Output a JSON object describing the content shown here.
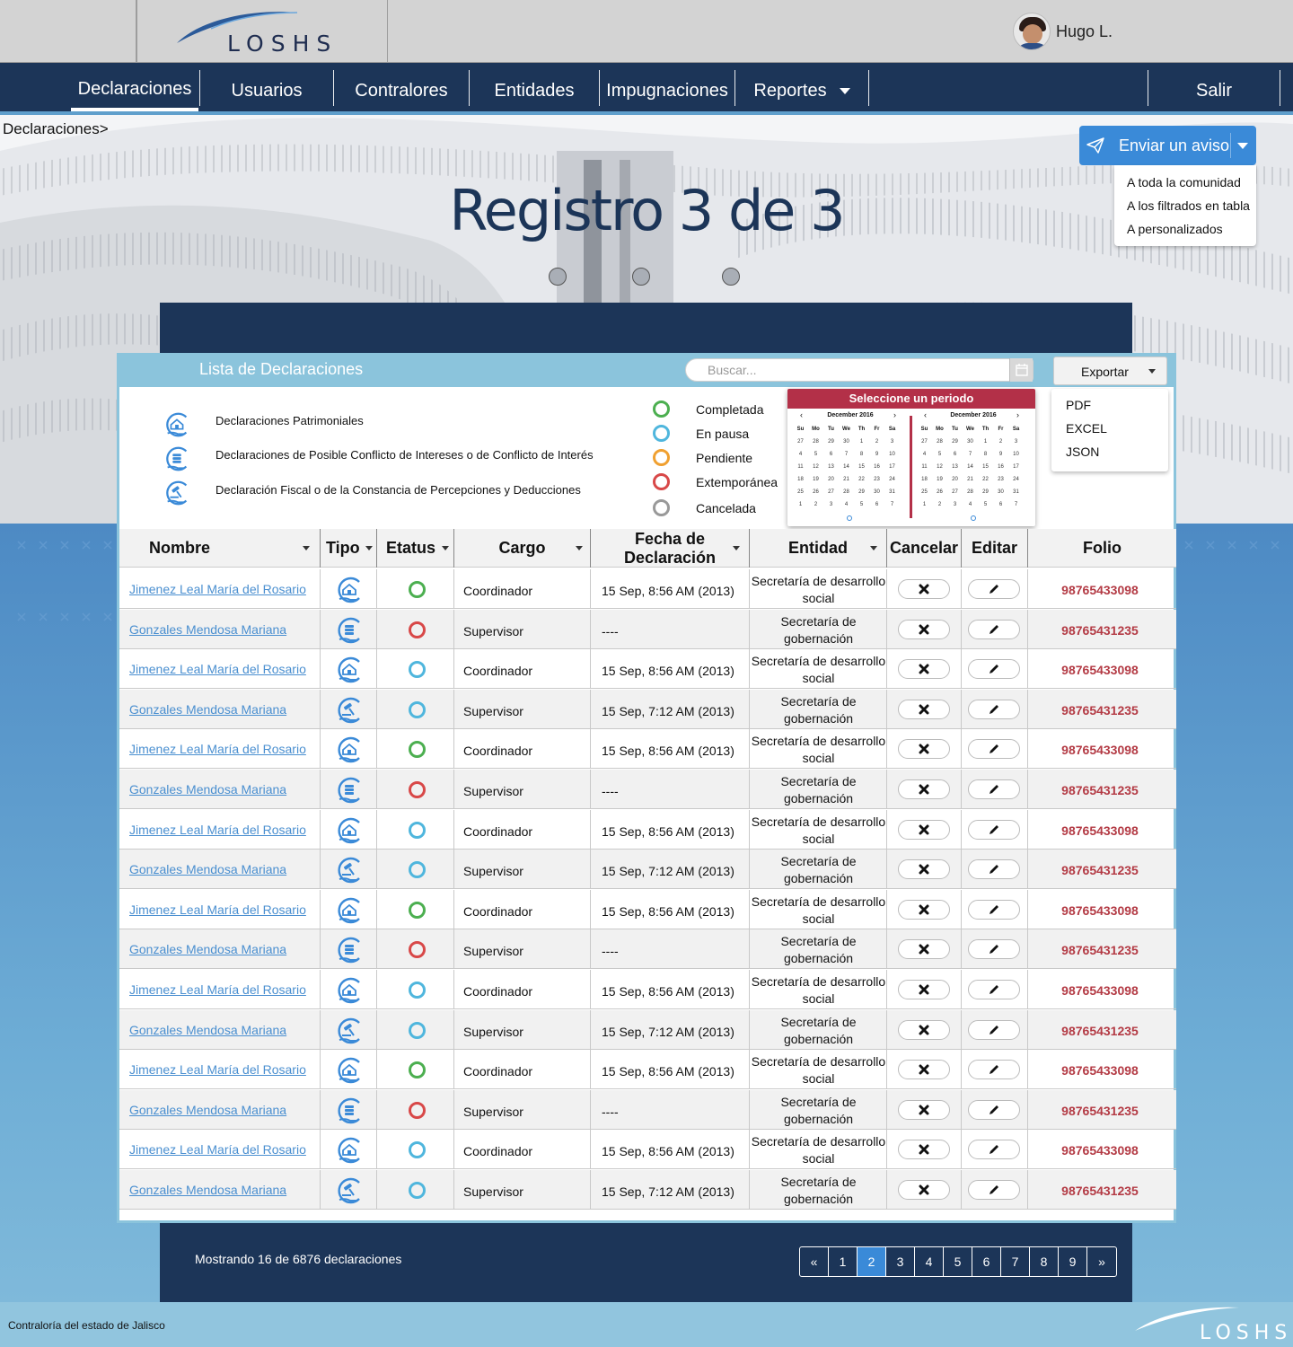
{
  "header": {
    "logo_text": "LOSHS",
    "user_name": "Hugo L."
  },
  "nav": {
    "items": [
      "Declaraciones",
      "Usuarios",
      "Contralores",
      "Entidades",
      "Impugnaciones",
      "Reportes"
    ],
    "active": "Declaraciones",
    "logout": "Salir"
  },
  "breadcrumb": "Declaraciones>",
  "hero": {
    "title": "Registro 3 de 3",
    "carousel_dots": 3
  },
  "notice": {
    "button_label": "Enviar un aviso",
    "options": [
      "A toda la comunidad",
      "A los filtrados en tabla",
      "A personalizados"
    ]
  },
  "panel": {
    "title": "Lista de Declaraciones",
    "search_placeholder": "Buscar...",
    "export_label": "Exportar",
    "export_options": [
      "PDF",
      "EXCEL",
      "JSON"
    ]
  },
  "legend": {
    "types": [
      {
        "icon": "house-hand-icon",
        "label": "Declaraciones Patrimoniales"
      },
      {
        "icon": "coins-hand-icon",
        "label": "Declaraciones de Posible Conflicto de Intereses o de Conflicto de Interés"
      },
      {
        "icon": "gavel-hand-icon",
        "label": "Declaración Fiscal o de la Constancia de Percepciones y Deducciones"
      }
    ],
    "statuses": [
      {
        "label": "Completada",
        "color": "#4caf50"
      },
      {
        "label": "En pausa",
        "color": "#4fb6dd"
      },
      {
        "label": "Pendiente",
        "color": "#f0a030"
      },
      {
        "label": "Extemporánea",
        "color": "#d84848"
      },
      {
        "label": "Cancelada",
        "color": "#999999"
      }
    ]
  },
  "calendar": {
    "title": "Seleccione un periodo",
    "months": [
      "December 2016",
      "December 2016"
    ],
    "weekdays": [
      "Su",
      "Mo",
      "Tu",
      "We",
      "Th",
      "Fr",
      "Sa"
    ],
    "days": [
      "27",
      "28",
      "29",
      "30",
      "1",
      "2",
      "3",
      "4",
      "5",
      "6",
      "7",
      "8",
      "9",
      "10",
      "11",
      "12",
      "13",
      "14",
      "15",
      "16",
      "17",
      "18",
      "19",
      "20",
      "21",
      "22",
      "23",
      "24",
      "25",
      "26",
      "27",
      "28",
      "29",
      "30",
      "31",
      "1",
      "2",
      "3",
      "4",
      "5",
      "6",
      "7"
    ]
  },
  "table": {
    "columns": [
      "Nombre",
      "Tipo",
      "Etatus",
      "Cargo",
      "Fecha de Declaración",
      "Entidad",
      "Cancelar",
      "Editar",
      "Folio"
    ],
    "rows": [
      {
        "nombre": "Jimenez Leal María del Rosario",
        "tipo": "house-hand-icon",
        "status": "Completada",
        "status_color": "#4caf50",
        "cargo": "Coordinador",
        "fecha": "15 Sep, 8:56 AM (2013)",
        "entidad": "Secretaría de desarrollo social",
        "folio": "98765433098"
      },
      {
        "nombre": "Gonzales Mendosa Mariana",
        "tipo": "coins-hand-icon",
        "status": "Extemporánea",
        "status_color": "#d84848",
        "cargo": "Supervisor",
        "fecha": "----",
        "entidad": "Secretaría de gobernación",
        "folio": "98765431235"
      },
      {
        "nombre": "Jimenez Leal María del Rosario",
        "tipo": "house-hand-icon",
        "status": "En pausa",
        "status_color": "#4fb6dd",
        "cargo": "Coordinador",
        "fecha": "15 Sep, 8:56 AM (2013)",
        "entidad": "Secretaría de desarrollo social",
        "folio": "98765433098"
      },
      {
        "nombre": "Gonzales Mendosa Mariana",
        "tipo": "gavel-hand-icon",
        "status": "En pausa",
        "status_color": "#4fb6dd",
        "cargo": "Supervisor",
        "fecha": "15 Sep, 7:12 AM (2013)",
        "entidad": "Secretaría de gobernación",
        "folio": "98765431235"
      },
      {
        "nombre": "Jimenez Leal María del Rosario",
        "tipo": "house-hand-icon",
        "status": "Completada",
        "status_color": "#4caf50",
        "cargo": "Coordinador",
        "fecha": "15 Sep, 8:56 AM (2013)",
        "entidad": "Secretaría de desarrollo social",
        "folio": "98765433098"
      },
      {
        "nombre": "Gonzales Mendosa Mariana",
        "tipo": "coins-hand-icon",
        "status": "Extemporánea",
        "status_color": "#d84848",
        "cargo": "Supervisor",
        "fecha": "----",
        "entidad": "Secretaría de gobernación",
        "folio": "98765431235"
      },
      {
        "nombre": "Jimenez Leal María del Rosario",
        "tipo": "house-hand-icon",
        "status": "En pausa",
        "status_color": "#4fb6dd",
        "cargo": "Coordinador",
        "fecha": "15 Sep, 8:56 AM (2013)",
        "entidad": "Secretaría de desarrollo social",
        "folio": "98765433098"
      },
      {
        "nombre": "Gonzales Mendosa Mariana",
        "tipo": "gavel-hand-icon",
        "status": "En pausa",
        "status_color": "#4fb6dd",
        "cargo": "Supervisor",
        "fecha": "15 Sep, 7:12 AM (2013)",
        "entidad": "Secretaría de gobernación",
        "folio": "98765431235"
      },
      {
        "nombre": "Jimenez Leal María del Rosario",
        "tipo": "house-hand-icon",
        "status": "Completada",
        "status_color": "#4caf50",
        "cargo": "Coordinador",
        "fecha": "15 Sep, 8:56 AM (2013)",
        "entidad": "Secretaría de desarrollo social",
        "folio": "98765433098"
      },
      {
        "nombre": "Gonzales Mendosa Mariana",
        "tipo": "coins-hand-icon",
        "status": "Extemporánea",
        "status_color": "#d84848",
        "cargo": "Supervisor",
        "fecha": "----",
        "entidad": "Secretaría de gobernación",
        "folio": "98765431235"
      },
      {
        "nombre": "Jimenez Leal María del Rosario",
        "tipo": "house-hand-icon",
        "status": "En pausa",
        "status_color": "#4fb6dd",
        "cargo": "Coordinador",
        "fecha": "15 Sep, 8:56 AM (2013)",
        "entidad": "Secretaría de desarrollo social",
        "folio": "98765433098"
      },
      {
        "nombre": "Gonzales Mendosa Mariana",
        "tipo": "gavel-hand-icon",
        "status": "En pausa",
        "status_color": "#4fb6dd",
        "cargo": "Supervisor",
        "fecha": "15 Sep, 7:12 AM (2013)",
        "entidad": "Secretaría de gobernación",
        "folio": "98765431235"
      },
      {
        "nombre": "Jimenez Leal María del Rosario",
        "tipo": "house-hand-icon",
        "status": "Completada",
        "status_color": "#4caf50",
        "cargo": "Coordinador",
        "fecha": "15 Sep, 8:56 AM (2013)",
        "entidad": "Secretaría de desarrollo social",
        "folio": "98765433098"
      },
      {
        "nombre": "Gonzales Mendosa Mariana",
        "tipo": "coins-hand-icon",
        "status": "Extemporánea",
        "status_color": "#d84848",
        "cargo": "Supervisor",
        "fecha": "----",
        "entidad": "Secretaría de gobernación",
        "folio": "98765431235"
      },
      {
        "nombre": "Jimenez Leal María del Rosario",
        "tipo": "house-hand-icon",
        "status": "En pausa",
        "status_color": "#4fb6dd",
        "cargo": "Coordinador",
        "fecha": "15 Sep, 8:56 AM (2013)",
        "entidad": "Secretaría de desarrollo social",
        "folio": "98765433098"
      },
      {
        "nombre": "Gonzales Mendosa Mariana",
        "tipo": "gavel-hand-icon",
        "status": "En pausa",
        "status_color": "#4fb6dd",
        "cargo": "Supervisor",
        "fecha": "15 Sep, 7:12 AM (2013)",
        "entidad": "Secretaría de gobernación",
        "folio": "98765431235"
      }
    ]
  },
  "pagination": {
    "summary": "Mostrando 16 de 6876 declaraciones",
    "prev": "«",
    "pages": [
      "1",
      "2",
      "3",
      "4",
      "5",
      "6",
      "7",
      "8",
      "9"
    ],
    "current": "2",
    "next": "»"
  },
  "footer": {
    "text": "Contraloría del estado de Jalisco",
    "logo_text": "LOSHS"
  },
  "colors": {
    "navy": "#1c3558",
    "accent_blue": "#3a8ad8",
    "panel_header": "#8bc4dc",
    "folio_red": "#b33a44",
    "calendar_red": "#b33048"
  }
}
